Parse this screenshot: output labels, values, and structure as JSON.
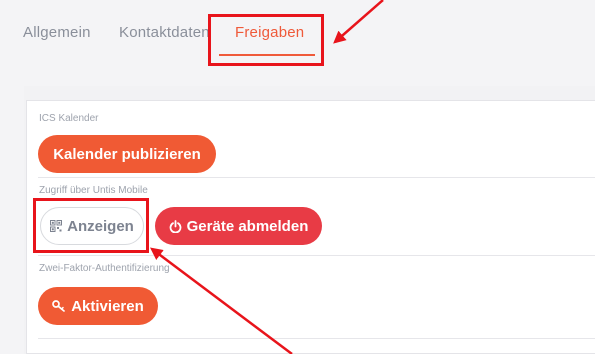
{
  "tabs": {
    "items": [
      {
        "label": "Allgemein"
      },
      {
        "label": "Kontaktdaten"
      },
      {
        "label": "Freigaben",
        "active": true
      }
    ]
  },
  "sections": {
    "ics": {
      "label": "ICS Kalender",
      "publish_button": "Kalender publizieren"
    },
    "untis_mobile": {
      "label": "Zugriff über Untis Mobile",
      "show_button": "Anzeigen",
      "show_icon": "qr-code-icon",
      "logout_button": "Geräte abmelden",
      "logout_icon": "power-icon"
    },
    "two_factor": {
      "label": "Zwei-Faktor-Authentifizierung",
      "activate_button": "Aktivieren",
      "activate_icon": "key-icon"
    }
  },
  "colors": {
    "accent": "#ef5a3a",
    "danger": "#e83b45",
    "annotation": "#e8141b"
  }
}
